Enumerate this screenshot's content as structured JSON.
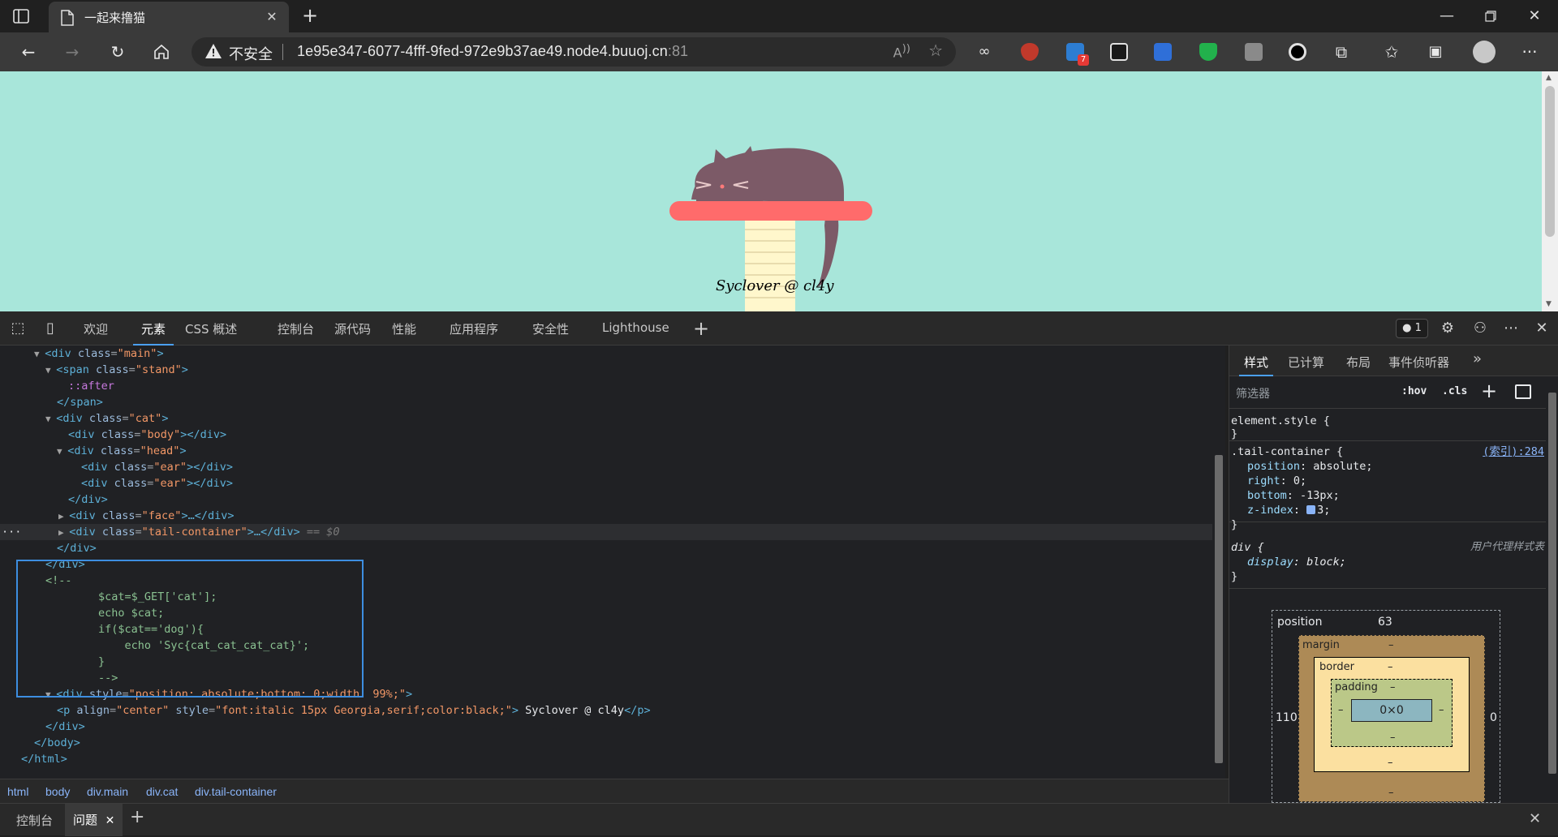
{
  "browser": {
    "tab_title": "一起来撸猫",
    "security_label": "不安全",
    "url_host": "1e95e347-6077-4fff-9fed-972e9b37ae49.node4.buuoj.cn",
    "url_port": ":81",
    "extension_badge": "7"
  },
  "page": {
    "credit_text": "Syclover @ cl4y",
    "background_color": "#a8e6da"
  },
  "devtools": {
    "tabs": [
      "欢迎",
      "元素",
      "CSS 概述",
      "控制台",
      "源代码",
      "性能",
      "应用程序",
      "安全性",
      "Lighthouse"
    ],
    "active_tab": "元素",
    "issues_count": "1",
    "elements_lines": {
      "l1_tag": "<div ",
      "l1_attr": "class",
      "l1_val": "\"main\"",
      "l1_end": ">",
      "l2_tag": "<span ",
      "l2_attr": "class",
      "l2_val": "\"stand\"",
      "l2_end": ">",
      "l3": "::after",
      "l4": "</span>",
      "l5_tag": "<div ",
      "l5_attr": "class",
      "l5_val": "\"cat\"",
      "l5_end": ">",
      "l6_tag": "<div ",
      "l6_attr": "class",
      "l6_val": "\"body\"",
      "l6_end": "></div>",
      "l7_tag": "<div ",
      "l7_attr": "class",
      "l7_val": "\"head\"",
      "l7_end": ">",
      "l8_tag": "<div ",
      "l8_attr": "class",
      "l8_val": "\"ear\"",
      "l8_end": "></div>",
      "l9_tag": "<div ",
      "l9_attr": "class",
      "l9_val": "\"ear\"",
      "l9_end": "></div>",
      "l10": "</div>",
      "l11_tag": "<div ",
      "l11_attr": "class",
      "l11_val": "\"face\"",
      "l11_end": ">…</div>",
      "l12_tag": "<div ",
      "l12_attr": "class",
      "l12_val": "\"tail-container\"",
      "l12_end": ">…</div>",
      "l12_ref": " == $0",
      "l13": "</div>",
      "l14": "</div>",
      "l15": "<!--",
      "l16": "        $cat=$_GET['cat'];",
      "l17": "        echo $cat;",
      "l18": "        if($cat=='dog'){",
      "l19": "            echo 'Syc{cat_cat_cat_cat}';",
      "l20": "        }",
      "l21": "        -->",
      "l22_tag": "<div ",
      "l22_attr": "style",
      "l22_val": "\"position: absolute;bottom: 0;width: 99%;\"",
      "l22_end": ">",
      "l23_tag": "<p ",
      "l23_attr1": "align",
      "l23_val1": "\"center\"",
      "l23_attr2": "style",
      "l23_val2": "\"font:italic 15px Georgia,serif;color:black;\"",
      "l23_mid": ">",
      "l23_text": " Syclover @ cl4y",
      "l23_end": "</p>",
      "l24": "</div>",
      "l25": "</body>",
      "l26": "</html>"
    },
    "breadcrumb": [
      "html",
      "body",
      "div.main",
      "div.cat",
      "div.tail-container"
    ],
    "styles": {
      "tabs": [
        "样式",
        "已计算",
        "布局",
        "事件侦听器"
      ],
      "filter_placeholder": "筛选器",
      "hov": ":hov",
      "cls": ".cls",
      "element_style": "element.style {",
      "close_brace": "}",
      "rule1_selector": ".tail-container {",
      "rule1_source": "(索引):284",
      "rule1_props": [
        {
          "name": "position",
          "value": "absolute;"
        },
        {
          "name": "right",
          "value": "0;"
        },
        {
          "name": "bottom",
          "value": "-13px;"
        },
        {
          "name": "z-index",
          "value": "3;"
        }
      ],
      "rule2_selector": "div {",
      "rule2_source": "用户代理样式表",
      "rule2_prop_name": "display",
      "rule2_prop_value": "block;"
    },
    "box_model": {
      "position_label": "position",
      "position_top": "63",
      "position_left": "110",
      "position_right": "0",
      "margin_label": "margin",
      "border_label": "border",
      "padding_label": "padding",
      "content": "0×0",
      "dash": "–"
    },
    "drawer_tabs": [
      "控制台",
      "问题"
    ]
  }
}
